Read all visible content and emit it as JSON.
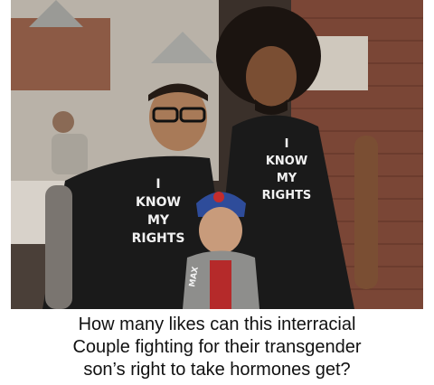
{
  "photo": {
    "shirt_left": [
      "I",
      "KNOW",
      "MY",
      "RIGHTS"
    ],
    "shirt_right": [
      "I",
      "KNOW",
      "MY",
      "RIGHTS"
    ],
    "sleeve_text": "MAX",
    "colors": {
      "brick": "#7a4636",
      "shirt": "#1a1a1a",
      "background_wall": "#c9c3bb"
    }
  },
  "caption": {
    "line1": "How many likes can this interracial",
    "line2": "Couple fighting for their transgender",
    "line3": "son’s right to take hormones get?"
  }
}
